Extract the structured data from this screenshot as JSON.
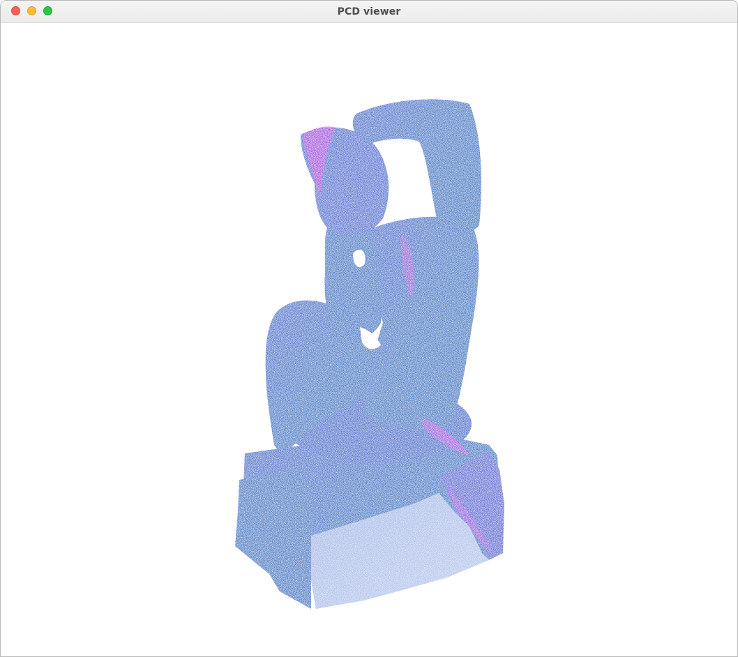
{
  "window": {
    "title": "PCD viewer",
    "buttons": {
      "close": "close-button",
      "minimize": "minimize-button",
      "maximize": "maximize-button"
    }
  },
  "viewport": {
    "background": "#ffffff",
    "point_colors": [
      "#3a78c8",
      "#4a6fd0",
      "#b040e0",
      "#d040f0"
    ],
    "model": "sculpture-point-cloud"
  }
}
